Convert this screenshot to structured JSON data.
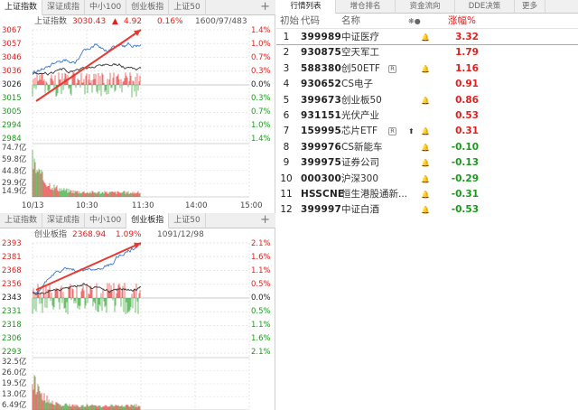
{
  "top_panel": {
    "tabs": [
      "上证指数",
      "深证成指",
      "中小100",
      "创业板指",
      "上证50"
    ],
    "active_tab": 0,
    "plus": "+",
    "name": "上证指数",
    "price": "3030.43",
    "arrow": "▲",
    "change": "4.92",
    "pct": "0.16%",
    "breadth": "1600/97/483",
    "left_axis": [
      "3067",
      "3057",
      "3046",
      "3036",
      "3026",
      "3015",
      "3005",
      "2994",
      "2984"
    ],
    "right_axis": [
      "1.4%",
      "1.0%",
      "0.7%",
      "0.3%",
      "0.0%",
      "0.3%",
      "0.7%",
      "1.0%",
      "1.4%"
    ],
    "volume_axis": [
      "74.7亿",
      "59.8亿",
      "44.8亿",
      "29.9亿",
      "14.9亿"
    ],
    "time_axis": [
      "10/13",
      "10:30",
      "11:30",
      "14:00",
      "15:00"
    ]
  },
  "bottom_panel": {
    "tabs": [
      "上证指数",
      "深证成指",
      "中小100",
      "创业板指",
      "上证50"
    ],
    "active_tab": 3,
    "plus": "+",
    "name": "创业板指",
    "price": "2368.94",
    "pct": "1.09%",
    "breadth": "1091/12/98",
    "left_axis": [
      "2393",
      "2381",
      "2368",
      "2356",
      "2343",
      "2331",
      "2318",
      "2306",
      "2293"
    ],
    "right_axis": [
      "2.1%",
      "1.6%",
      "1.1%",
      "0.5%",
      "0.0%",
      "0.5%",
      "1.1%",
      "1.6%",
      "2.1%"
    ],
    "volume_axis": [
      "32.5亿",
      "26.0亿",
      "19.5亿",
      "13.0亿",
      "6.49亿"
    ]
  },
  "market_list": {
    "tabs": [
      "行情列表",
      "增仓排名",
      "资金流向",
      "DDE决策",
      "更多"
    ],
    "active_tab": 0,
    "headers": {
      "initial": "初始",
      "code": "代码",
      "name": "名称",
      "icons": "❋●",
      "change": "涨幅%"
    },
    "rows": [
      {
        "idx": "1",
        "code": "399989",
        "name": "中证医疗",
        "tag": "",
        "up": "",
        "bell": "🔔",
        "change": "3.32",
        "dir": "up"
      },
      {
        "idx": "2",
        "code": "930875",
        "name": "空天军工",
        "tag": "",
        "up": "",
        "bell": "",
        "change": "1.79",
        "dir": "up"
      },
      {
        "idx": "3",
        "code": "588380",
        "name": "创50ETF",
        "tag": "R",
        "up": "",
        "bell": "🔔",
        "change": "1.16",
        "dir": "up"
      },
      {
        "idx": "4",
        "code": "930652",
        "name": "CS电子",
        "tag": "",
        "up": "",
        "bell": "",
        "change": "0.91",
        "dir": "up"
      },
      {
        "idx": "5",
        "code": "399673",
        "name": "创业板50",
        "tag": "",
        "up": "",
        "bell": "🔔",
        "change": "0.86",
        "dir": "up"
      },
      {
        "idx": "6",
        "code": "931151",
        "name": "光伏产业",
        "tag": "",
        "up": "",
        "bell": "",
        "change": "0.53",
        "dir": "up"
      },
      {
        "idx": "7",
        "code": "159995",
        "name": "芯片ETF",
        "tag": "R",
        "up": "⬆",
        "bell": "🔔",
        "change": "0.31",
        "dir": "up"
      },
      {
        "idx": "8",
        "code": "399976",
        "name": "CS新能车",
        "tag": "",
        "up": "",
        "bell": "🔔",
        "change": "-0.10",
        "dir": "down"
      },
      {
        "idx": "9",
        "code": "399975",
        "name": "证券公司",
        "tag": "",
        "up": "",
        "bell": "🔔",
        "change": "-0.13",
        "dir": "down"
      },
      {
        "idx": "10",
        "code": "000300",
        "name": "沪深300",
        "tag": "",
        "up": "",
        "bell": "🔔",
        "change": "-0.29",
        "dir": "down"
      },
      {
        "idx": "11",
        "code": "HSSCNE",
        "name": "恒生港股通新...",
        "tag": "",
        "up": "",
        "bell": "🔔",
        "change": "-0.31",
        "dir": "down"
      },
      {
        "idx": "12",
        "code": "399997",
        "name": "中证白酒",
        "tag": "",
        "up": "",
        "bell": "🔔",
        "change": "-0.53",
        "dir": "down"
      }
    ]
  },
  "colors": {
    "up": "#e0211e",
    "down": "#1a9a1a",
    "price_line": "#3c78c8",
    "avg_line": "#333333",
    "arrow": "#e8382f"
  }
}
